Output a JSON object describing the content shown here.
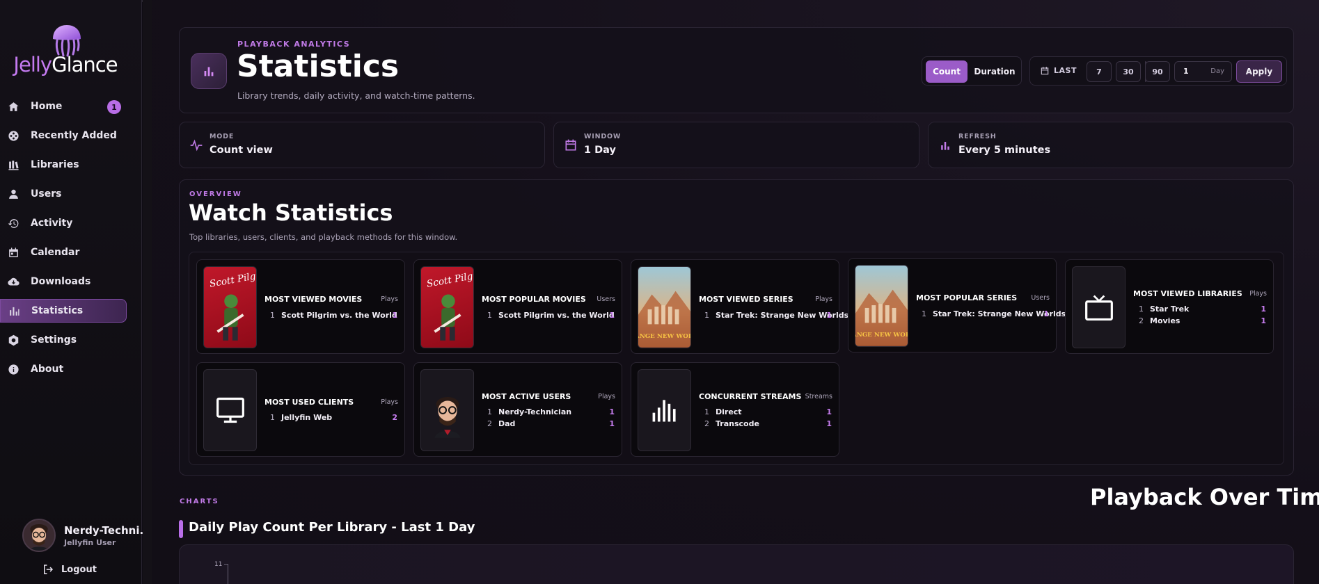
{
  "app": {
    "name_part1": "Jelly",
    "name_part2": "Glance"
  },
  "sidebar": {
    "items": [
      {
        "label": "Home",
        "icon": "home-icon",
        "badge": "1"
      },
      {
        "label": "Recently Added",
        "icon": "film-reel-icon"
      },
      {
        "label": "Libraries",
        "icon": "library-icon"
      },
      {
        "label": "Users",
        "icon": "user-icon"
      },
      {
        "label": "Activity",
        "icon": "history-icon"
      },
      {
        "label": "Calendar",
        "icon": "calendar-icon"
      },
      {
        "label": "Downloads",
        "icon": "cloud-download-icon"
      },
      {
        "label": "Statistics",
        "icon": "bar-chart-icon",
        "active": true
      },
      {
        "label": "Settings",
        "icon": "gear-icon"
      },
      {
        "label": "About",
        "icon": "info-icon"
      }
    ],
    "user": {
      "name": "Nerdy-Techni...",
      "role": "Jellyfin User"
    },
    "logout_label": "Logout"
  },
  "header": {
    "eyebrow": "PLAYBACK ANALYTICS",
    "title": "Statistics",
    "subtitle": "Library trends, daily activity, and watch-time patterns.",
    "mode_options": [
      "Count",
      "Duration"
    ],
    "selected_mode": "Count",
    "range_label": "LAST",
    "range_chips": [
      "7",
      "30",
      "90"
    ],
    "range_value": "1",
    "range_unit": "Day",
    "apply_label": "Apply"
  },
  "info_cards": [
    {
      "label": "MODE",
      "value": "Count view",
      "icon": "activity-icon"
    },
    {
      "label": "WINDOW",
      "value": "1 Day",
      "icon": "calendar-icon"
    },
    {
      "label": "REFRESH",
      "value": "Every 5 minutes",
      "icon": "bar-chart-icon"
    }
  ],
  "overview": {
    "eyebrow": "OVERVIEW",
    "title": "Watch Statistics",
    "subtitle": "Top libraries, users, clients, and playback methods for this window.",
    "cards": [
      {
        "title": "MOST VIEWED MOVIES",
        "unit": "Plays",
        "thumb": "poster-scott-pilgrim",
        "rows": [
          {
            "rank": "1",
            "name": "Scott Pilgrim vs. the World",
            "count": "1"
          }
        ]
      },
      {
        "title": "MOST POPULAR MOVIES",
        "unit": "Users",
        "thumb": "poster-scott-pilgrim",
        "rows": [
          {
            "rank": "1",
            "name": "Scott Pilgrim vs. the World",
            "count": "1"
          }
        ]
      },
      {
        "title": "MOST VIEWED SERIES",
        "unit": "Plays",
        "thumb": "poster-strange-new-worlds",
        "rows": [
          {
            "rank": "1",
            "name": "Star Trek: Strange New Worlds",
            "count": "1"
          }
        ]
      },
      {
        "title": "MOST POPULAR SERIES",
        "unit": "Users",
        "thumb": "poster-strange-new-worlds",
        "rows": [
          {
            "rank": "1",
            "name": "Star Trek: Strange New Worlds",
            "count": "1"
          }
        ]
      },
      {
        "title": "MOST VIEWED LIBRARIES",
        "unit": "Plays",
        "thumb": "tv-icon",
        "rows": [
          {
            "rank": "1",
            "name": "Star Trek",
            "count": "1"
          },
          {
            "rank": "2",
            "name": "Movies",
            "count": "1"
          }
        ]
      },
      {
        "title": "MOST USED CLIENTS",
        "unit": "Plays",
        "thumb": "monitor-icon",
        "rows": [
          {
            "rank": "1",
            "name": "Jellyfin Web",
            "count": "2"
          }
        ]
      },
      {
        "title": "MOST ACTIVE USERS",
        "unit": "Plays",
        "thumb": "user-avatar",
        "rows": [
          {
            "rank": "1",
            "name": "Nerdy-Technician",
            "count": "1"
          },
          {
            "rank": "2",
            "name": "Dad",
            "count": "1"
          }
        ]
      },
      {
        "title": "CONCURRENT STREAMS",
        "unit": "Streams",
        "thumb": "equalizer-icon",
        "rows": [
          {
            "rank": "1",
            "name": "Direct",
            "count": "1"
          },
          {
            "rank": "2",
            "name": "Transcode",
            "count": "1"
          }
        ]
      }
    ]
  },
  "charts": {
    "eyebrow": "CHARTS",
    "section_title": "Playback Over Time",
    "chart_title": "Daily Play Count Per Library - Last 1 Day",
    "y_top_tick": "11"
  },
  "colors": {
    "accent": "#b96ee8",
    "accent_text": "#c07ae6",
    "count_text": "#c87ef0"
  }
}
